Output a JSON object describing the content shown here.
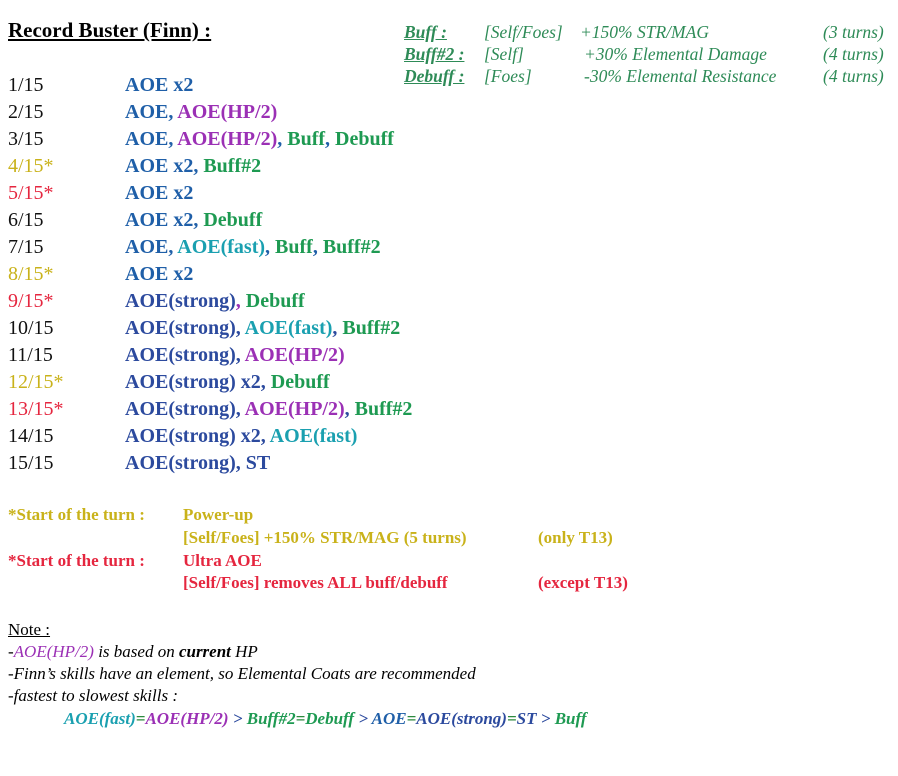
{
  "title": "Record Buster (Finn) :",
  "legend": [
    {
      "key": "Buff :",
      "target": "[Self/Foes]",
      "effect": "+150% STR/MAG",
      "duration": "(3 turns)"
    },
    {
      "key": "Buff#2 :",
      "target": "[Self]",
      "effect": "+30%  Elemental Damage",
      "duration": "(4 turns)"
    },
    {
      "key": "Debuff :",
      "target": "[Foes]",
      "effect": "-30% Elemental Resistance",
      "duration": "(4 turns)"
    }
  ],
  "turns": [
    {
      "num": "1/15",
      "numColor": "black",
      "parts": [
        {
          "t": "AOE x2",
          "c": "blue"
        }
      ]
    },
    {
      "num": "2/15",
      "numColor": "black",
      "parts": [
        {
          "t": "AOE, ",
          "c": "blue"
        },
        {
          "t": "AOE(HP/2)",
          "c": "purple"
        }
      ]
    },
    {
      "num": "3/15",
      "numColor": "black",
      "parts": [
        {
          "t": "AOE, ",
          "c": "blue"
        },
        {
          "t": "AOE(HP/2)",
          "c": "purple"
        },
        {
          "t": ", ",
          "c": "blue"
        },
        {
          "t": "Buff",
          "c": "green"
        },
        {
          "t": ", ",
          "c": "blue"
        },
        {
          "t": "Debuff",
          "c": "green"
        }
      ]
    },
    {
      "num": "4/15*",
      "numColor": "yellow",
      "parts": [
        {
          "t": "AOE x2, ",
          "c": "blue"
        },
        {
          "t": "Buff#2",
          "c": "green"
        }
      ]
    },
    {
      "num": "5/15*",
      "numColor": "red",
      "parts": [
        {
          "t": "AOE x2",
          "c": "blue"
        }
      ]
    },
    {
      "num": "6/15",
      "numColor": "black",
      "parts": [
        {
          "t": "AOE x2, ",
          "c": "blue"
        },
        {
          "t": "Debuff",
          "c": "green"
        }
      ]
    },
    {
      "num": "7/15",
      "numColor": "black",
      "parts": [
        {
          "t": "AOE, ",
          "c": "blue"
        },
        {
          "t": "AOE(fast)",
          "c": "teal"
        },
        {
          "t": ", ",
          "c": "blue"
        },
        {
          "t": "Buff",
          "c": "green"
        },
        {
          "t": ", ",
          "c": "blue"
        },
        {
          "t": "Buff#2",
          "c": "green"
        }
      ]
    },
    {
      "num": "8/15*",
      "numColor": "yellow",
      "parts": [
        {
          "t": "AOE x2",
          "c": "blue"
        }
      ]
    },
    {
      "num": "9/15*",
      "numColor": "red",
      "parts": [
        {
          "t": "AOE(strong)",
          "c": "navy"
        },
        {
          "t": ", ",
          "c": "purple"
        },
        {
          "t": "Debuff",
          "c": "green"
        }
      ]
    },
    {
      "num": "10/15",
      "numColor": "black",
      "parts": [
        {
          "t": "AOE(strong), ",
          "c": "navy"
        },
        {
          "t": "AOE(fast)",
          "c": "teal"
        },
        {
          "t": ", ",
          "c": "navy"
        },
        {
          "t": "Buff#2",
          "c": "green"
        }
      ]
    },
    {
      "num": "11/15",
      "numColor": "black",
      "parts": [
        {
          "t": "AOE(strong), ",
          "c": "navy"
        },
        {
          "t": "AOE(HP/2)",
          "c": "purple"
        }
      ]
    },
    {
      "num": "12/15*",
      "numColor": "yellow",
      "parts": [
        {
          "t": "AOE(strong) x2, ",
          "c": "navy"
        },
        {
          "t": "Debuff",
          "c": "green"
        }
      ]
    },
    {
      "num": "13/15*",
      "numColor": "red",
      "parts": [
        {
          "t": "AOE(strong), ",
          "c": "navy"
        },
        {
          "t": "AOE(HP/2)",
          "c": "purple"
        },
        {
          "t": ", ",
          "c": "navy"
        },
        {
          "t": "Buff#2",
          "c": "green"
        }
      ]
    },
    {
      "num": "14/15",
      "numColor": "black",
      "parts": [
        {
          "t": "AOE(strong) x2, ",
          "c": "navy"
        },
        {
          "t": "AOE(fast)",
          "c": "teal"
        }
      ]
    },
    {
      "num": "15/15",
      "numColor": "black",
      "parts": [
        {
          "t": "AOE(strong), ST",
          "c": "navy"
        }
      ]
    }
  ],
  "start_of_turn": [
    {
      "label": "*Start of the turn :",
      "name": "Power-up",
      "detail": "[Self/Foes] +150% STR/MAG (5 turns)",
      "cond": "(only T13)",
      "color": "yellow"
    },
    {
      "label": "*Start of the turn :",
      "name": "Ultra AOE",
      "detail": "[Self/Foes] removes ALL buff/debuff",
      "cond": "(except T13)",
      "color": "red"
    }
  ],
  "note": {
    "heading": "Note :",
    "line1_prefix": "-",
    "line1_skill": "AOE(HP/2)",
    "line1_a": " is based on ",
    "line1_bold": "current",
    "line1_b": " HP",
    "line2": "-Finn’s skills have an element, so Elemental Coats are recommended",
    "line3": "-fastest to slowest skills :",
    "order": [
      {
        "t": "AOE(fast)",
        "c": "teal"
      },
      {
        "t": "=",
        "c": "dgreen"
      },
      {
        "t": "AOE(HP/2)",
        "c": "purple"
      },
      {
        "t": " > ",
        "c": "navy"
      },
      {
        "t": "Buff#2",
        "c": "green"
      },
      {
        "t": "=",
        "c": "dgreen"
      },
      {
        "t": "Debuff",
        "c": "green"
      },
      {
        "t": " > ",
        "c": "navy"
      },
      {
        "t": "AOE",
        "c": "blue"
      },
      {
        "t": "=",
        "c": "dgreen"
      },
      {
        "t": "AOE(strong)",
        "c": "navy"
      },
      {
        "t": "=",
        "c": "dgreen"
      },
      {
        "t": "ST",
        "c": "navy"
      },
      {
        "t": " > ",
        "c": "navy"
      },
      {
        "t": "Buff",
        "c": "green"
      }
    ]
  },
  "colors": {
    "blue": "#1f5fa8",
    "navy": "#2c4a9e",
    "purple": "#9b30b5",
    "green": "#1e9a52",
    "teal": "#1aa0b0",
    "black": "#111111",
    "yellow": "#c9b21a",
    "red": "#e5263f",
    "dgreen": "#2b8a3e"
  }
}
